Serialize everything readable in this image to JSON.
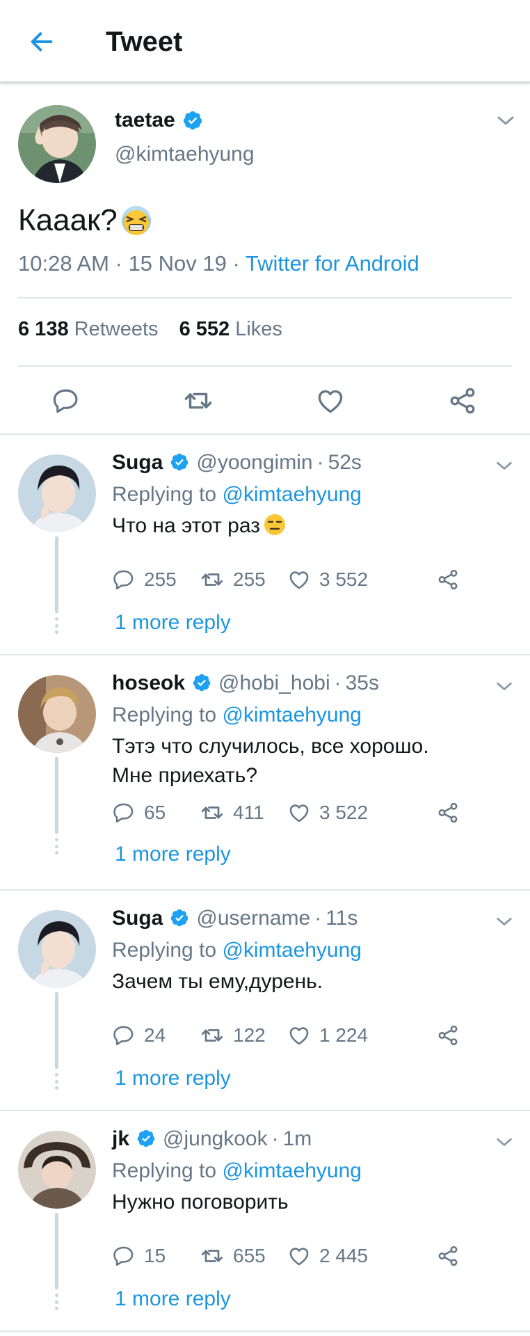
{
  "header": {
    "title": "Tweet",
    "back_icon": "arrow-left-icon"
  },
  "colors": {
    "accent": "#1b95e0",
    "secondary_text": "#657786",
    "primary_text": "#14171a",
    "divider": "#e1e6ea"
  },
  "main_tweet": {
    "name": "taetae",
    "handle": "@kimtaehyung",
    "text": "Кааак?",
    "emoji": "tired-face-emoji",
    "time": "10:28 AM",
    "date": "15 Nov 19",
    "source": "Twitter for Android",
    "retweets_count": "6 138",
    "retweets_label": "Retweets",
    "likes_count": "6 552",
    "likes_label": "Likes"
  },
  "replies": [
    {
      "name": "Suga",
      "handle": "@yoongimin",
      "time": "52s",
      "replying_prefix": "Replying to",
      "replying_handle": "@kimtaehyung",
      "text": "Что на этот раз",
      "emoji": "expressionless-face-emoji",
      "reply_count": "255",
      "retweet_count": "255",
      "like_count": "3 552",
      "more_reply": "1 more reply"
    },
    {
      "name": "hoseok",
      "handle": "@hobi_hobi",
      "time": "35s",
      "replying_prefix": "Replying to",
      "replying_handle": "@kimtaehyung",
      "text": "Тэтэ что случилось, все хорошо. Мне приехать?",
      "reply_count": "65",
      "retweet_count": "411",
      "like_count": "3 522",
      "more_reply": "1 more reply"
    },
    {
      "name": "Suga",
      "handle": "@username",
      "time": "11s",
      "replying_prefix": "Replying to",
      "replying_handle": "@kimtaehyung",
      "text": "Зачем ты ему,дурень.",
      "reply_count": "24",
      "retweet_count": "122",
      "like_count": "1 224",
      "more_reply": "1 more reply"
    },
    {
      "name": "jk",
      "handle": "@jungkook",
      "time": "1m",
      "replying_prefix": "Replying to",
      "replying_handle": "@kimtaehyung",
      "text": "Нужно поговорить",
      "reply_count": "15",
      "retweet_count": "655",
      "like_count": "2 445",
      "more_reply": "1 more reply"
    }
  ],
  "separator": "·"
}
